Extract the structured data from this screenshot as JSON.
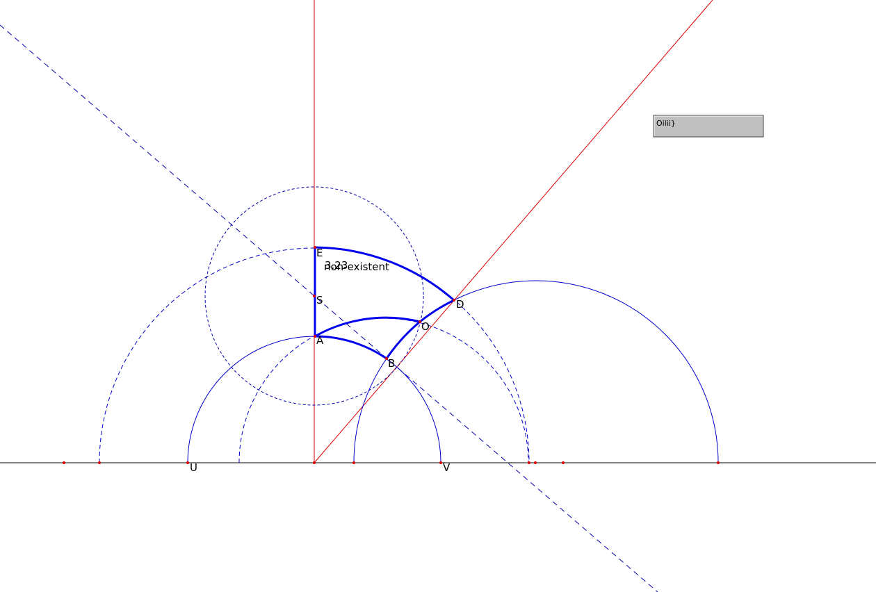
{
  "colors": {
    "background": "#ffffff",
    "axis": "#000000",
    "red_line": "#e00000",
    "circle": "#0000cc",
    "highlight": "#0000ee",
    "point": "#dd0000",
    "button_fill": "#c0c0c0"
  },
  "points": {
    "E": "E",
    "S": "S",
    "A": "A",
    "B": "B",
    "O": "O",
    "D": "D",
    "U": "U",
    "V": "V"
  },
  "overlay": {
    "measure_text": "3.23",
    "nonexistent_text": "non-existent"
  },
  "button": {
    "label": "Oilii}"
  }
}
